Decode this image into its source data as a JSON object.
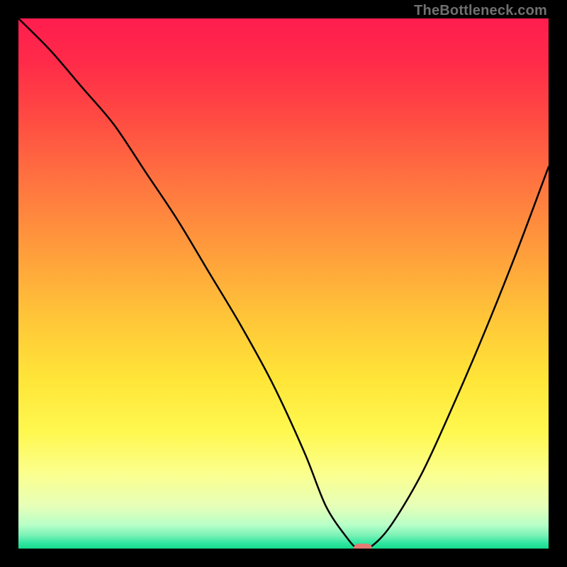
{
  "watermark": {
    "text": "TheBottleneck.com"
  },
  "chart_data": {
    "type": "line",
    "title": "",
    "xlabel": "",
    "ylabel": "",
    "xlim": [
      0,
      100
    ],
    "ylim": [
      0,
      100
    ],
    "x": [
      0,
      6,
      12,
      18,
      24,
      30,
      36,
      42,
      48,
      54,
      58,
      62,
      64,
      66,
      70,
      76,
      82,
      88,
      94,
      100
    ],
    "values": [
      100,
      94,
      87,
      80,
      71,
      62,
      52,
      42,
      31,
      18,
      8,
      2,
      0,
      0,
      4,
      14,
      27,
      41,
      56,
      72
    ],
    "marker": {
      "x": 65,
      "y": 0
    },
    "gradient_stops": [
      {
        "offset": 0.0,
        "color": "#ff1d4f"
      },
      {
        "offset": 0.08,
        "color": "#ff2a49"
      },
      {
        "offset": 0.18,
        "color": "#ff4843"
      },
      {
        "offset": 0.3,
        "color": "#ff7140"
      },
      {
        "offset": 0.43,
        "color": "#ff9a3c"
      },
      {
        "offset": 0.56,
        "color": "#ffc438"
      },
      {
        "offset": 0.68,
        "color": "#ffe538"
      },
      {
        "offset": 0.78,
        "color": "#fff84f"
      },
      {
        "offset": 0.86,
        "color": "#fbff8f"
      },
      {
        "offset": 0.92,
        "color": "#e6ffb8"
      },
      {
        "offset": 0.955,
        "color": "#b8ffc8"
      },
      {
        "offset": 0.975,
        "color": "#7af2b6"
      },
      {
        "offset": 0.99,
        "color": "#2fe6a0"
      },
      {
        "offset": 1.0,
        "color": "#17d98b"
      }
    ]
  }
}
